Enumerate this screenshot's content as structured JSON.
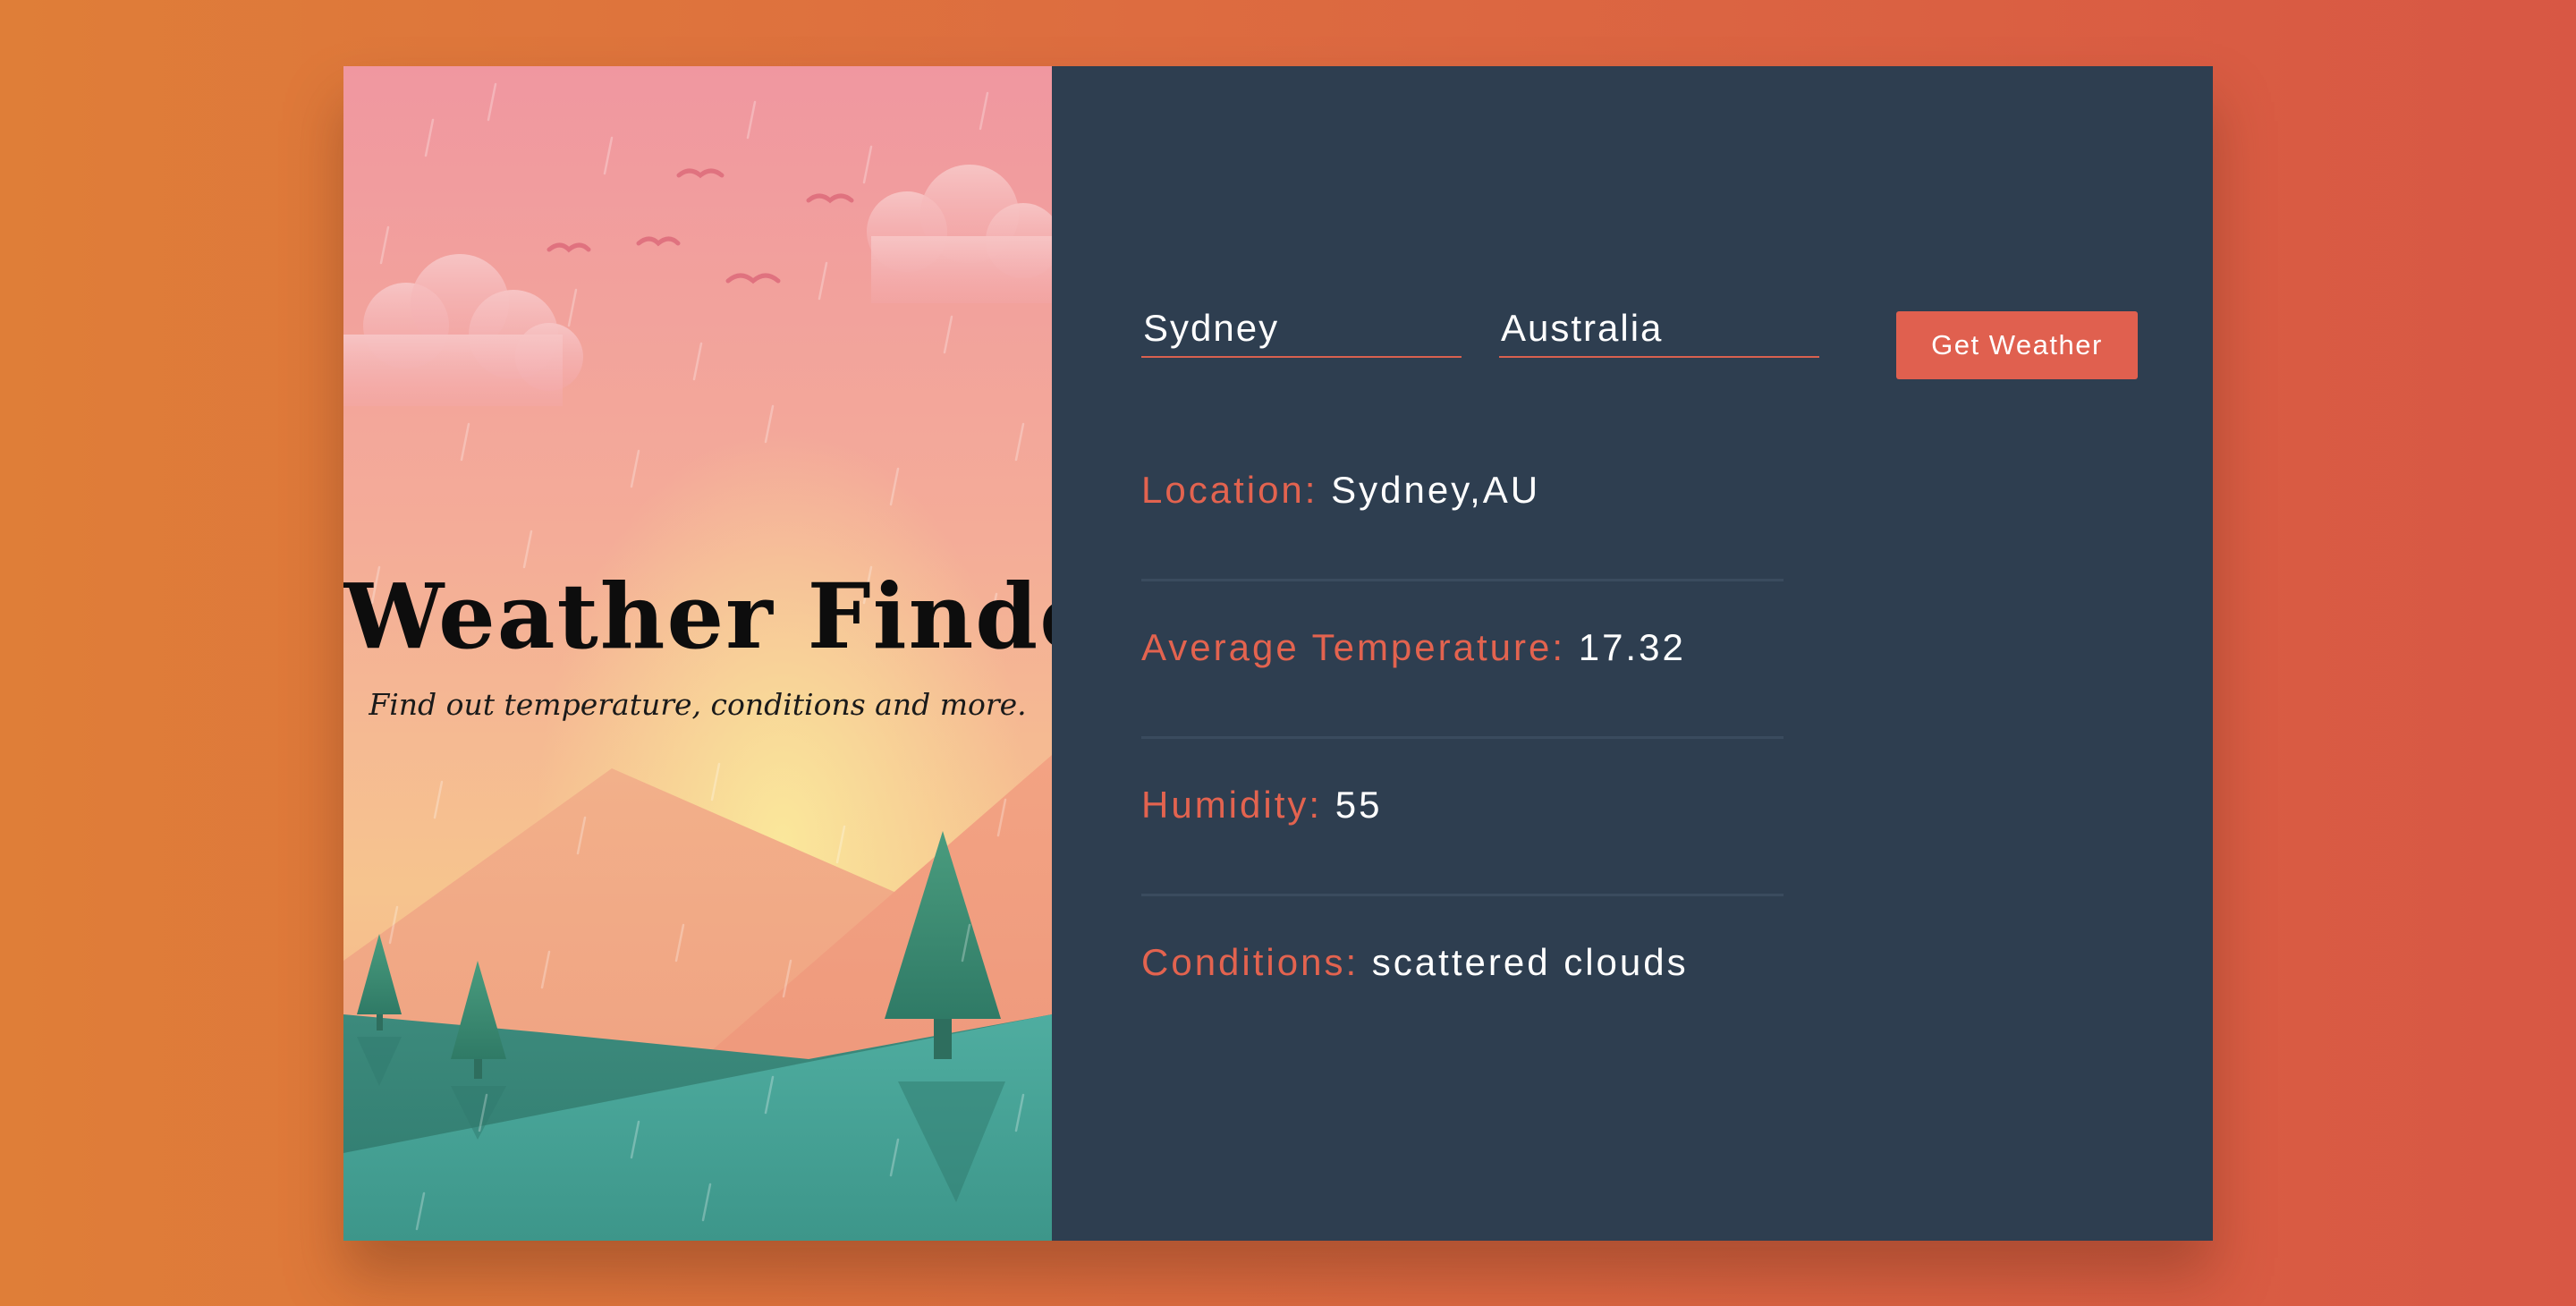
{
  "hero": {
    "title": "Weather Finder",
    "subtitle": "Find out temperature, conditions and more."
  },
  "form": {
    "city_value": "Sydney",
    "country_value": "Australia",
    "submit_label": "Get Weather"
  },
  "results": [
    {
      "key": "Location:",
      "value": "Sydney,AU"
    },
    {
      "key": "Average Temperature:",
      "value": "17.32"
    },
    {
      "key": "Humidity:",
      "value": "55"
    },
    {
      "key": "Conditions:",
      "value": "scattered clouds"
    }
  ],
  "colors": {
    "accent": "#e0604f",
    "panel_bg": "#2e3e50",
    "page_bg_start": "#df7e38",
    "page_bg_end": "#d85744",
    "sky_top": "#f097a0",
    "sun_glow": "#f9e096",
    "hills": "#3f9a90",
    "trees": "#3c8a70"
  }
}
